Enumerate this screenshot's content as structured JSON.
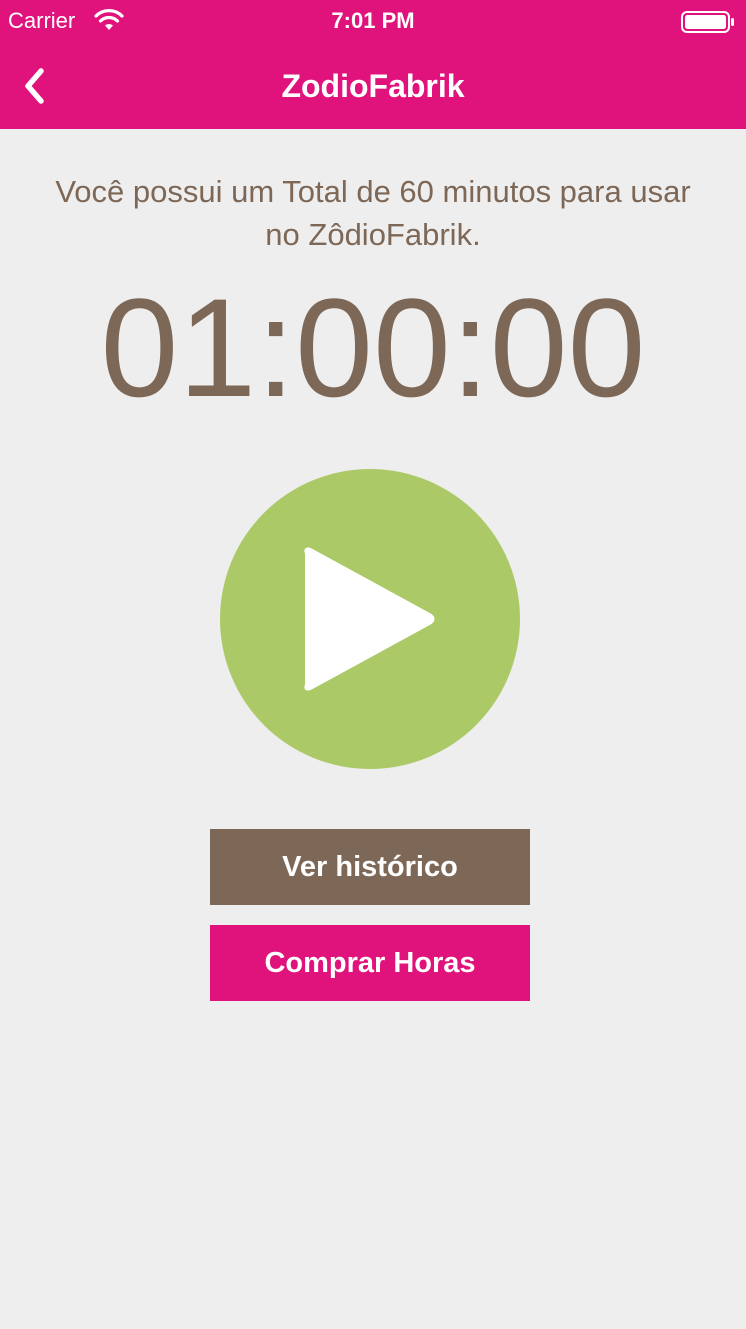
{
  "status_bar": {
    "carrier": "Carrier",
    "time": "7:01 PM",
    "wifi_icon": "wifi-icon",
    "battery_icon": "battery-icon"
  },
  "nav": {
    "back_icon": "chevron-left-icon",
    "title": "ZodioFabrik"
  },
  "main": {
    "info_text": "Você possui um Total de 60 minutos para usar\nno ZôdioFabrik.",
    "timer": "01:00:00",
    "play_icon": "play-icon",
    "history_button_label": "Ver histórico",
    "buy_button_label": "Comprar Horas"
  },
  "colors": {
    "brand_pink": "#e0137c",
    "brown": "#7d6857",
    "play_green": "#abc967",
    "background": "#efeeee"
  }
}
